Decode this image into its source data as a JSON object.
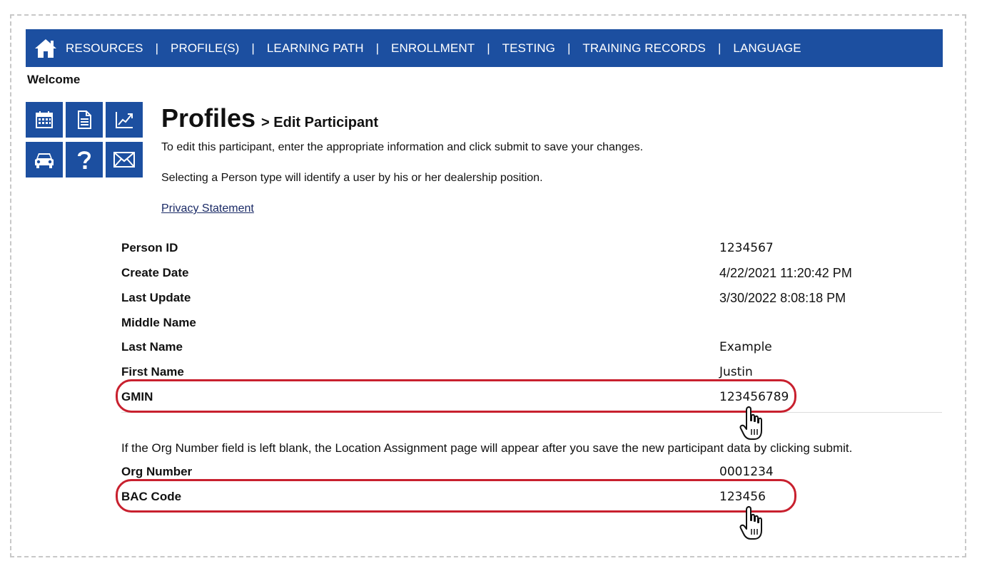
{
  "nav": {
    "items": [
      "RESOURCES",
      "PROFILE(S)",
      "LEARNING PATH",
      "ENROLLMENT",
      "TESTING",
      "TRAINING RECORDS",
      "LANGUAGE"
    ],
    "separator": "|",
    "bg_color": "#1c4fa0"
  },
  "welcome": "Welcome",
  "icons": [
    "calendar-icon",
    "document-icon",
    "chart-icon",
    "car-icon",
    "help-icon",
    "mail-icon"
  ],
  "page": {
    "title": "Profiles",
    "subtitle": "> Edit Participant",
    "intro1": "To edit this participant, enter the appropriate information and click submit to save your changes.",
    "intro2": "Selecting a Person type will identify a user by his or her dealership position.",
    "privacy_link": "Privacy Statement"
  },
  "fields": {
    "person_id": {
      "label": "Person ID",
      "value": "1234567"
    },
    "create_date": {
      "label": "Create Date",
      "value": "4/22/2021 11:20:42 PM"
    },
    "last_update": {
      "label": "Last Update",
      "value": "3/30/2022 8:08:18 PM"
    },
    "middle_name": {
      "label": "Middle Name",
      "value": ""
    },
    "last_name": {
      "label": "Last Name",
      "value": "Example"
    },
    "first_name": {
      "label": "First Name",
      "value": "Justin"
    },
    "gmin": {
      "label": "GMIN",
      "value": "123456789"
    }
  },
  "org_note": "If the Org Number field is left blank, the Location Assignment page will appear after you save the new participant data by clicking submit.",
  "org_fields": {
    "org_number": {
      "label": "Org Number",
      "value": "0001234"
    },
    "bac_code": {
      "label": "BAC Code",
      "value": "123456"
    }
  },
  "highlight_color": "#c8202e"
}
